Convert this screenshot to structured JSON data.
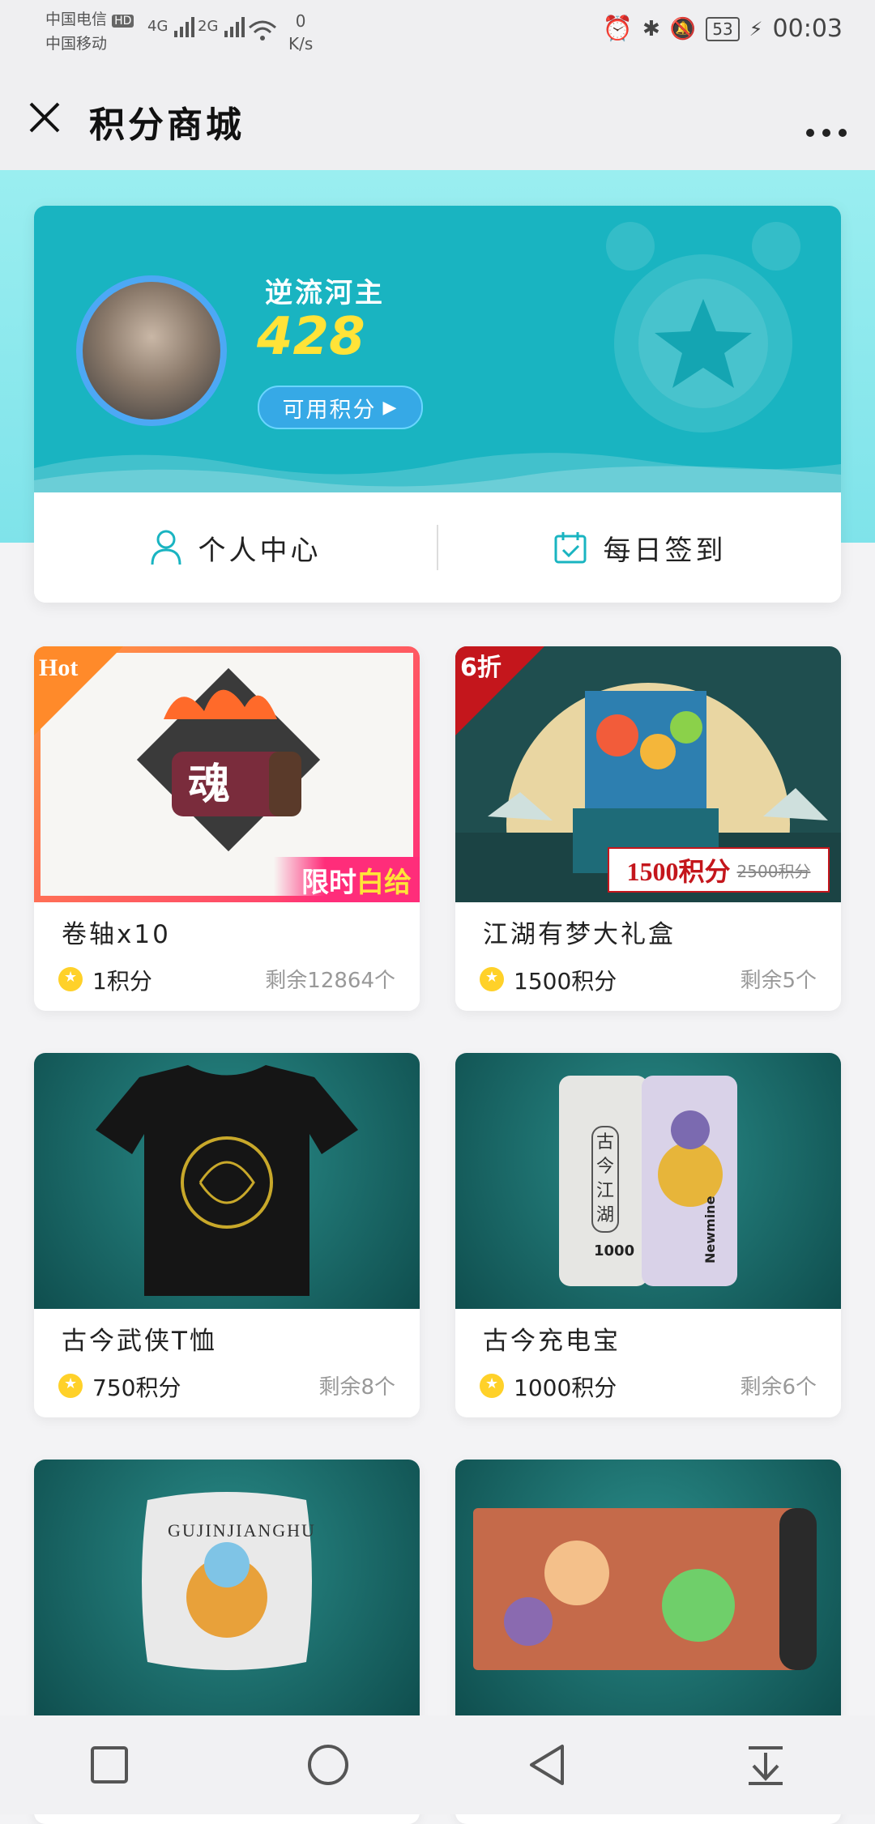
{
  "status_bar": {
    "carrier1": "中国电信",
    "carrier2": "中国移动",
    "hd": "HD",
    "net1": "4G",
    "net2": "2G",
    "speed_value": "0",
    "speed_unit": "K/s",
    "battery": "53",
    "time": "00:03"
  },
  "header": {
    "title": "积分商城"
  },
  "profile": {
    "username": "逆流河主",
    "points": "428",
    "available_points_label": "可用积分",
    "actions": [
      {
        "label": "个人中心",
        "icon": "person-icon"
      },
      {
        "label": "每日签到",
        "icon": "calendar-check-icon"
      }
    ]
  },
  "products": [
    {
      "name": "卷轴x10",
      "price": "1积分",
      "stock": "剩余12864个",
      "tag": "Hot",
      "badge_text_1": "限时",
      "badge_text_2": "白给",
      "scroll_glyph": "魂"
    },
    {
      "name": "江湖有梦大礼盒",
      "price": "1500积分",
      "stock": "剩余5个",
      "tag": "6折",
      "promo_price": "1500积分",
      "promo_original": "2500积分"
    },
    {
      "name": "古今武侠T恤",
      "price": "750积分",
      "stock": "剩余8个"
    },
    {
      "name": "古今充电宝",
      "price": "1000积分",
      "stock": "剩余6个",
      "powerbank_text": "古今江湖",
      "brand": "Newmine",
      "capacity": "1000"
    },
    {
      "name": "",
      "price": "",
      "stock": "",
      "pillow_text": "GUJINJIANGHU"
    },
    {
      "name": "",
      "price": "",
      "stock": ""
    }
  ],
  "colors": {
    "accent": "#19b4c1",
    "points": "#ffe338",
    "coin": "#ffd129"
  }
}
